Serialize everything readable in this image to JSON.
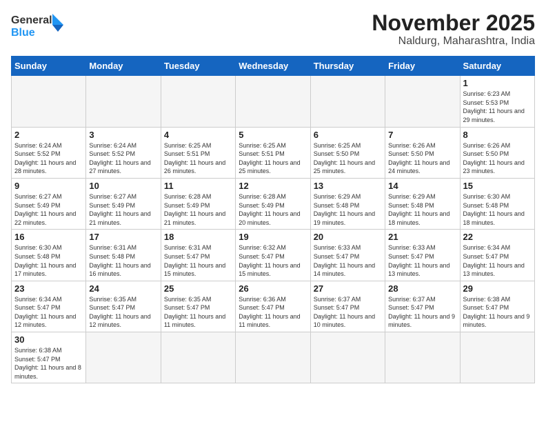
{
  "header": {
    "logo_general": "General",
    "logo_blue": "Blue",
    "month_title": "November 2025",
    "location": "Naldurg, Maharashtra, India"
  },
  "weekdays": [
    "Sunday",
    "Monday",
    "Tuesday",
    "Wednesday",
    "Thursday",
    "Friday",
    "Saturday"
  ],
  "weeks": [
    [
      {
        "day": "",
        "content": ""
      },
      {
        "day": "",
        "content": ""
      },
      {
        "day": "",
        "content": ""
      },
      {
        "day": "",
        "content": ""
      },
      {
        "day": "",
        "content": ""
      },
      {
        "day": "",
        "content": ""
      },
      {
        "day": "1",
        "content": "Sunrise: 6:23 AM\nSunset: 5:53 PM\nDaylight: 11 hours\nand 29 minutes."
      }
    ],
    [
      {
        "day": "2",
        "content": "Sunrise: 6:24 AM\nSunset: 5:52 PM\nDaylight: 11 hours\nand 28 minutes."
      },
      {
        "day": "3",
        "content": "Sunrise: 6:24 AM\nSunset: 5:52 PM\nDaylight: 11 hours\nand 27 minutes."
      },
      {
        "day": "4",
        "content": "Sunrise: 6:25 AM\nSunset: 5:51 PM\nDaylight: 11 hours\nand 26 minutes."
      },
      {
        "day": "5",
        "content": "Sunrise: 6:25 AM\nSunset: 5:51 PM\nDaylight: 11 hours\nand 25 minutes."
      },
      {
        "day": "6",
        "content": "Sunrise: 6:25 AM\nSunset: 5:50 PM\nDaylight: 11 hours\nand 25 minutes."
      },
      {
        "day": "7",
        "content": "Sunrise: 6:26 AM\nSunset: 5:50 PM\nDaylight: 11 hours\nand 24 minutes."
      },
      {
        "day": "8",
        "content": "Sunrise: 6:26 AM\nSunset: 5:50 PM\nDaylight: 11 hours\nand 23 minutes."
      }
    ],
    [
      {
        "day": "9",
        "content": "Sunrise: 6:27 AM\nSunset: 5:49 PM\nDaylight: 11 hours\nand 22 minutes."
      },
      {
        "day": "10",
        "content": "Sunrise: 6:27 AM\nSunset: 5:49 PM\nDaylight: 11 hours\nand 21 minutes."
      },
      {
        "day": "11",
        "content": "Sunrise: 6:28 AM\nSunset: 5:49 PM\nDaylight: 11 hours\nand 21 minutes."
      },
      {
        "day": "12",
        "content": "Sunrise: 6:28 AM\nSunset: 5:49 PM\nDaylight: 11 hours\nand 20 minutes."
      },
      {
        "day": "13",
        "content": "Sunrise: 6:29 AM\nSunset: 5:48 PM\nDaylight: 11 hours\nand 19 minutes."
      },
      {
        "day": "14",
        "content": "Sunrise: 6:29 AM\nSunset: 5:48 PM\nDaylight: 11 hours\nand 18 minutes."
      },
      {
        "day": "15",
        "content": "Sunrise: 6:30 AM\nSunset: 5:48 PM\nDaylight: 11 hours\nand 18 minutes."
      }
    ],
    [
      {
        "day": "16",
        "content": "Sunrise: 6:30 AM\nSunset: 5:48 PM\nDaylight: 11 hours\nand 17 minutes."
      },
      {
        "day": "17",
        "content": "Sunrise: 6:31 AM\nSunset: 5:48 PM\nDaylight: 11 hours\nand 16 minutes."
      },
      {
        "day": "18",
        "content": "Sunrise: 6:31 AM\nSunset: 5:47 PM\nDaylight: 11 hours\nand 15 minutes."
      },
      {
        "day": "19",
        "content": "Sunrise: 6:32 AM\nSunset: 5:47 PM\nDaylight: 11 hours\nand 15 minutes."
      },
      {
        "day": "20",
        "content": "Sunrise: 6:33 AM\nSunset: 5:47 PM\nDaylight: 11 hours\nand 14 minutes."
      },
      {
        "day": "21",
        "content": "Sunrise: 6:33 AM\nSunset: 5:47 PM\nDaylight: 11 hours\nand 13 minutes."
      },
      {
        "day": "22",
        "content": "Sunrise: 6:34 AM\nSunset: 5:47 PM\nDaylight: 11 hours\nand 13 minutes."
      }
    ],
    [
      {
        "day": "23",
        "content": "Sunrise: 6:34 AM\nSunset: 5:47 PM\nDaylight: 11 hours\nand 12 minutes."
      },
      {
        "day": "24",
        "content": "Sunrise: 6:35 AM\nSunset: 5:47 PM\nDaylight: 11 hours\nand 12 minutes."
      },
      {
        "day": "25",
        "content": "Sunrise: 6:35 AM\nSunset: 5:47 PM\nDaylight: 11 hours\nand 11 minutes."
      },
      {
        "day": "26",
        "content": "Sunrise: 6:36 AM\nSunset: 5:47 PM\nDaylight: 11 hours\nand 11 minutes."
      },
      {
        "day": "27",
        "content": "Sunrise: 6:37 AM\nSunset: 5:47 PM\nDaylight: 11 hours\nand 10 minutes."
      },
      {
        "day": "28",
        "content": "Sunrise: 6:37 AM\nSunset: 5:47 PM\nDaylight: 11 hours\nand 9 minutes."
      },
      {
        "day": "29",
        "content": "Sunrise: 6:38 AM\nSunset: 5:47 PM\nDaylight: 11 hours\nand 9 minutes."
      }
    ],
    [
      {
        "day": "30",
        "content": "Sunrise: 6:38 AM\nSunset: 5:47 PM\nDaylight: 11 hours\nand 8 minutes."
      },
      {
        "day": "",
        "content": ""
      },
      {
        "day": "",
        "content": ""
      },
      {
        "day": "",
        "content": ""
      },
      {
        "day": "",
        "content": ""
      },
      {
        "day": "",
        "content": ""
      },
      {
        "day": "",
        "content": ""
      }
    ]
  ]
}
